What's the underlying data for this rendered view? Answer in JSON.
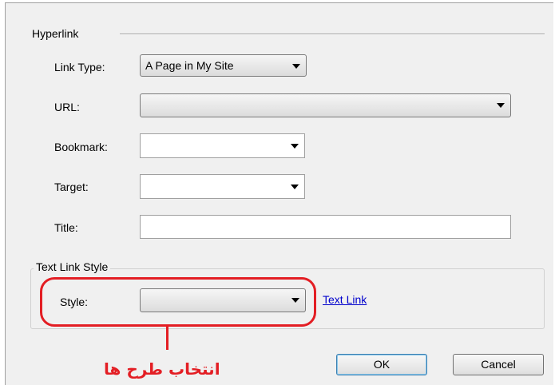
{
  "hyperlink": {
    "section_title": "Hyperlink",
    "link_type": {
      "label": "Link Type:",
      "value": "A Page in My Site"
    },
    "url": {
      "label": "URL:",
      "value": ""
    },
    "bookmark": {
      "label": "Bookmark:",
      "value": ""
    },
    "target": {
      "label": "Target:",
      "value": ""
    },
    "title": {
      "label": "Title:",
      "value": ""
    }
  },
  "text_link_style": {
    "group_title": "Text Link Style",
    "style": {
      "label": "Style:",
      "value": ""
    },
    "preview_link": "Text Link"
  },
  "annotation": {
    "text": "انتخاب طرح ها",
    "color": "#e31e24"
  },
  "buttons": {
    "ok": "OK",
    "cancel": "Cancel"
  }
}
